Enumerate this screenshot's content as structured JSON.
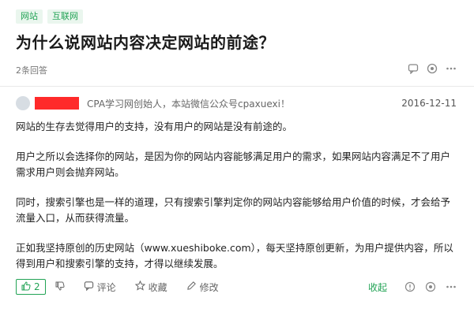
{
  "tags": [
    "网站",
    "互联网"
  ],
  "question": {
    "title": "为什么说网站内容决定网站的前途？",
    "answer_count": "2条回答"
  },
  "answer": {
    "bio": "CPA学习网创始人，本站微信公众号cpaxuexi！",
    "date": "2016-12-11",
    "paragraphs": [
      "网站的生存去觉得用户的支持，没有用户的网站是没有前途的。",
      "用户之所以会选择你的网站，是因为你的网站内容能够满足用户的需求，如果网站内容满足不了用户需求用户则会抛弃网站。",
      "同时，搜索引擎也是一样的道理，只有搜索引擎判定你的网站内容能够给用户价值的时候，才会给予流量入口，从而获得流量。",
      "正如我坚持原创的历史网站（www.xueshiboke.com），每天坚持原创更新，为用户提供内容，所以得到用户和搜索引擎的支持，才得以继续发展。"
    ]
  },
  "footer": {
    "vote_count": "2",
    "comment_label": "评论",
    "favorite_label": "收藏",
    "edit_label": "修改",
    "collect_label": "收起"
  },
  "colors": {
    "accent": "#22a355",
    "tag_bg": "#eaf6ee",
    "redaction": "#ff2a2a"
  },
  "icons": [
    "comment-icon",
    "eye-icon",
    "more-icon",
    "thumbs-up-icon",
    "thumbs-down-icon",
    "comment-icon",
    "star-icon",
    "pencil-icon",
    "warning-icon",
    "share-icon",
    "more-icon"
  ]
}
